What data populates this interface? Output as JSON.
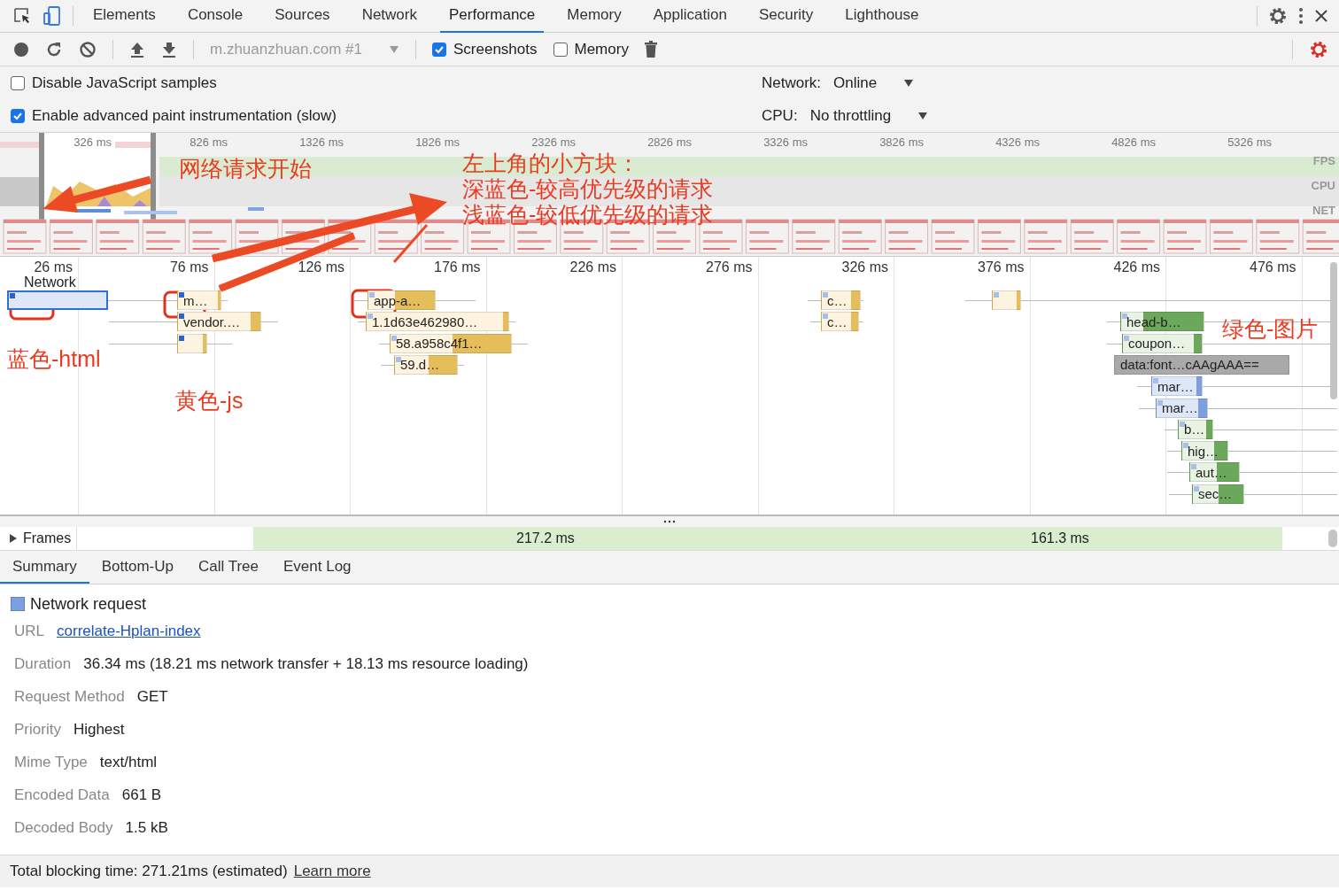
{
  "devtools_tabs": [
    {
      "label": "Elements",
      "selected": false
    },
    {
      "label": "Console",
      "selected": false
    },
    {
      "label": "Sources",
      "selected": false
    },
    {
      "label": "Network",
      "selected": false
    },
    {
      "label": "Performance",
      "selected": true
    },
    {
      "label": "Memory",
      "selected": false
    },
    {
      "label": "Application",
      "selected": false
    },
    {
      "label": "Security",
      "selected": false
    },
    {
      "label": "Lighthouse",
      "selected": false
    }
  ],
  "toolbar": {
    "target": "m.zhuanzhuan.com #1",
    "options": [
      {
        "label": "Screenshots",
        "checked": true
      },
      {
        "label": "Memory",
        "checked": false
      }
    ]
  },
  "settings": [
    {
      "label": "Disable JavaScript samples",
      "checked": false,
      "setting_label": "Network:",
      "setting_value": "Online"
    },
    {
      "label": "Enable advanced paint instrumentation (slow)",
      "checked": true,
      "setting_label": "CPU:",
      "setting_value": "No throttling"
    }
  ],
  "overview": {
    "ticks": [
      "326 ms",
      "826 ms",
      "1326 ms",
      "1826 ms",
      "2326 ms",
      "2826 ms",
      "3326 ms",
      "3826 ms",
      "4326 ms",
      "4826 ms",
      "5326 ms"
    ],
    "tracks": [
      "FPS",
      "CPU",
      "NET"
    ]
  },
  "timeline": {
    "ticks": [
      "26 ms",
      "76 ms",
      "126 ms",
      "176 ms",
      "226 ms",
      "276 ms",
      "326 ms",
      "376 ms",
      "426 ms",
      "476 ms"
    ],
    "section": "Network",
    "requests": [
      {
        "kind": "html",
        "high_priority": true,
        "selected": true
      },
      {
        "label": "m…",
        "kind": "js",
        "high_priority": true,
        "selected": false
      },
      {
        "label": "vendor.…",
        "kind": "js",
        "high_priority": true,
        "selected": false
      },
      {
        "kind": "js",
        "high_priority": true,
        "selected": false
      },
      {
        "label": "app-a…",
        "kind": "js",
        "high_priority": false,
        "selected": false
      },
      {
        "label": "1.1d63e462980…",
        "kind": "js",
        "high_priority": false,
        "selected": false
      },
      {
        "label": "58.a958c4f1…",
        "kind": "js",
        "high_priority": false,
        "selected": false
      },
      {
        "label": "59.d…",
        "kind": "js",
        "high_priority": false,
        "selected": false
      },
      {
        "label": "c…",
        "kind": "js",
        "high_priority": false,
        "selected": false
      },
      {
        "label": "c…",
        "kind": "js",
        "high_priority": false,
        "selected": false
      },
      {
        "kind": "js",
        "high_priority": false,
        "selected": false
      },
      {
        "label": "head-b…",
        "kind": "image",
        "high_priority": false,
        "selected": false
      },
      {
        "label": "coupon…",
        "kind": "image",
        "high_priority": false,
        "selected": false
      },
      {
        "label": "data:font…cAAgAAA==",
        "kind": "font",
        "selected": false
      },
      {
        "label": "mar…",
        "kind": "html",
        "high_priority": false,
        "selected": false
      },
      {
        "label": "mar…",
        "kind": "html",
        "high_priority": false,
        "selected": false
      },
      {
        "label": "b…",
        "kind": "image",
        "high_priority": false,
        "selected": false
      },
      {
        "label": "hig…",
        "kind": "image",
        "high_priority": false,
        "selected": false
      },
      {
        "label": "aut…",
        "kind": "image",
        "high_priority": false,
        "selected": false
      },
      {
        "label": "sec…",
        "kind": "image",
        "high_priority": false,
        "selected": false
      }
    ]
  },
  "frames": {
    "label": "Frames",
    "durations": [
      "217.2 ms",
      "161.3 ms"
    ]
  },
  "detail_tabs": [
    {
      "label": "Summary",
      "selected": true
    },
    {
      "label": "Bottom-Up",
      "selected": false
    },
    {
      "label": "Call Tree",
      "selected": false
    },
    {
      "label": "Event Log",
      "selected": false
    }
  ],
  "summary": {
    "title": "Network request",
    "rows": [
      {
        "label": "URL",
        "value": "correlate-Hplan-index",
        "kind": "link"
      },
      {
        "label": "Duration",
        "value": "36.34 ms (18.21 ms network transfer + 18.13 ms resource loading)",
        "kind": "text"
      },
      {
        "label": "Request Method",
        "value": "GET",
        "kind": "text"
      },
      {
        "label": "Priority",
        "value": "Highest",
        "kind": "text"
      },
      {
        "label": "Mime Type",
        "value": "text/html",
        "kind": "text"
      },
      {
        "label": "Encoded Data",
        "value": "661 B",
        "kind": "text"
      },
      {
        "label": "Decoded Body",
        "value": "1.5 kB",
        "kind": "text"
      }
    ]
  },
  "footer": {
    "text": "Total blocking time: 271.21ms (estimated)",
    "link": "Learn more"
  },
  "annotations": [
    "左上角的小方块：",
    "深蓝色-较高优先级的请求",
    "浅蓝色-较低优先级的请求",
    "网络请求开始",
    "蓝色-html",
    "黄色-js",
    "绿色-图片"
  ]
}
